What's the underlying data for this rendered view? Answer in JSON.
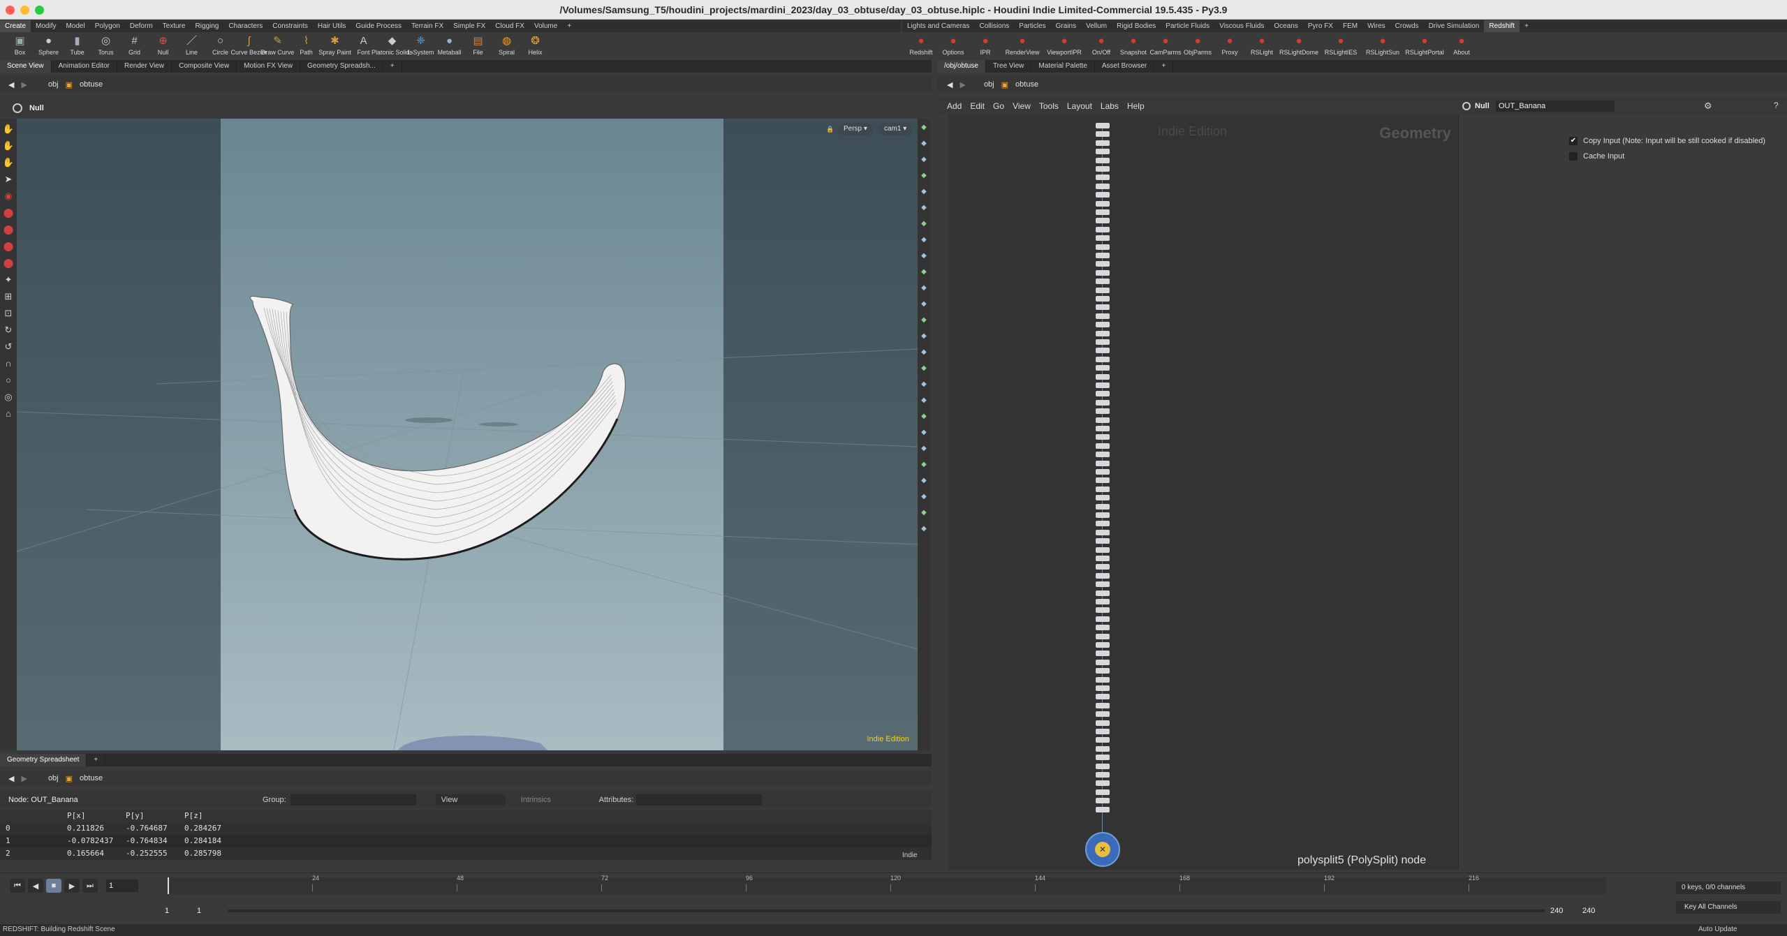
{
  "window": {
    "title": "/Volumes/Samsung_T5/houdini_projects/mardini_2023/day_03_obtuse/day_03_obtuse.hiplc - Houdini Indie Limited-Commercial 19.5.435 - Py3.9"
  },
  "shelf_left": {
    "tabs": [
      "Create",
      "Modify",
      "Model",
      "Polygon",
      "Deform",
      "Texture",
      "Rigging",
      "Characters",
      "Constraints",
      "Hair Utils",
      "Guide Process",
      "Terrain FX",
      "Simple FX",
      "Cloud FX",
      "Volume"
    ],
    "tools": [
      {
        "label": "Box",
        "icon": "box-icon"
      },
      {
        "label": "Sphere",
        "icon": "sphere-icon"
      },
      {
        "label": "Tube",
        "icon": "tube-icon"
      },
      {
        "label": "Torus",
        "icon": "torus-icon"
      },
      {
        "label": "Grid",
        "icon": "grid-icon"
      },
      {
        "label": "Null",
        "icon": "null-icon"
      },
      {
        "label": "Line",
        "icon": "line-icon"
      },
      {
        "label": "Circle",
        "icon": "circle-icon"
      },
      {
        "label": "Curve Bezier",
        "icon": "curve-bezier-icon"
      },
      {
        "label": "Draw Curve",
        "icon": "draw-curve-icon"
      },
      {
        "label": "Path",
        "icon": "path-icon"
      },
      {
        "label": "Spray Paint",
        "icon": "spray-paint-icon"
      },
      {
        "label": "Font",
        "icon": "font-icon"
      },
      {
        "label": "Platonic Solids",
        "icon": "platonic-icon"
      },
      {
        "label": "L-System",
        "icon": "lsystem-icon"
      },
      {
        "label": "Metaball",
        "icon": "metaball-icon"
      },
      {
        "label": "File",
        "icon": "file-icon"
      },
      {
        "label": "Spiral",
        "icon": "spiral-icon"
      },
      {
        "label": "Helix",
        "icon": "helix-icon"
      }
    ]
  },
  "shelf_right": {
    "tabs": [
      "Lights and Cameras",
      "Collisions",
      "Particles",
      "Grains",
      "Vellum",
      "Rigid Bodies",
      "Particle Fluids",
      "Viscous Fluids",
      "Oceans",
      "Pyro FX",
      "FEM",
      "Wires",
      "Crowds",
      "Drive Simulation",
      "Redshift"
    ],
    "tools": [
      "Redshift",
      "Options",
      "IPR",
      "RenderView",
      "ViewportIPR",
      "On/Off",
      "Snapshot",
      "CamParms",
      "ObjParms",
      "Proxy",
      "RSLight",
      "RSLightDome",
      "RSLightIES",
      "RSLightSun",
      "RSLightPortal",
      "About"
    ]
  },
  "left_pane": {
    "tabs": [
      "Scene View",
      "Animation Editor",
      "Render View",
      "Composite View",
      "Motion FX View",
      "Geometry Spreadsh..."
    ],
    "path": [
      "obj",
      "obtuse"
    ],
    "operator": "Null",
    "persp_label": "Persp",
    "camera_label": "cam1",
    "indie_label": "Indie Edition"
  },
  "spreadsheet": {
    "tab": "Geometry Spreadsheet",
    "path": [
      "obj",
      "obtuse"
    ],
    "node_label": "Node: OUT_Banana",
    "group_label": "Group:",
    "view_label": "View",
    "intrinsics_label": "Intrinsics",
    "attributes_label": "Attributes:",
    "columns": [
      "",
      "P[x]",
      "P[y]",
      "P[z]"
    ],
    "rows": [
      [
        "0",
        "0.211826",
        "-0.764687",
        "0.284267"
      ],
      [
        "1",
        "-0.0782437",
        "-0.764834",
        "0.284184"
      ],
      [
        "2",
        "0.165664",
        "-0.252555",
        "0.285798"
      ]
    ],
    "indie_tag": "Indie"
  },
  "network_pane": {
    "tabs": [
      "/obj/obtuse",
      "Tree View",
      "Material Palette",
      "Asset Browser"
    ],
    "path": [
      "obj",
      "obtuse"
    ],
    "menu": [
      "Add",
      "Edit",
      "Go",
      "View",
      "Tools",
      "Layout",
      "Labs",
      "Help"
    ],
    "watermark": "Indie Edition",
    "context_label": "Geometry",
    "node_info": "polysplit5 (PolySplit) node"
  },
  "params": {
    "node_type": "Null",
    "node_name": "OUT_Banana",
    "copy_input_label": "Copy Input (Note: Input will be still cooked if disabled)",
    "copy_input_checked": true,
    "cache_input_label": "Cache Input",
    "cache_input_checked": false
  },
  "timeline": {
    "current_frame": "1",
    "ticks": [
      "24",
      "48",
      "72",
      "96",
      "120",
      "144",
      "168",
      "192",
      "216"
    ],
    "range_start": "1",
    "range_start2": "1",
    "range_end": "240",
    "range_end2": "240",
    "keys_label": "0 keys, 0/0 channels",
    "key_all_label": "Key All Channels",
    "auto_update_label": "Auto Update"
  },
  "status": {
    "message": "REDSHIFT: Building Redshift Scene"
  },
  "colors": {
    "accent_orange": "#e8a33c",
    "redshift_red": "#d23c2c",
    "indie_yellow": "#f0d020",
    "viewport_bg": "#5a6d78"
  }
}
